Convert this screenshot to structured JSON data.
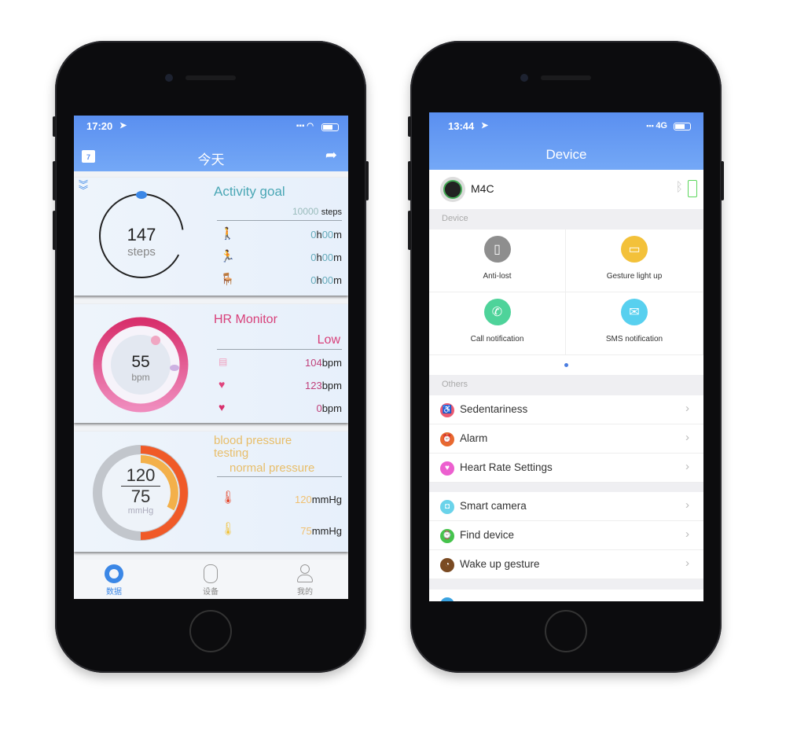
{
  "left_phone": {
    "status": {
      "time": "17:20",
      "location_icon": "location-arrow-icon",
      "signal_icon": "signal-icon",
      "wifi_icon": "wifi-icon",
      "battery_icon": "battery-icon"
    },
    "header": {
      "title": "今天",
      "calendar_day": "7"
    },
    "activity": {
      "title": "Activity goal",
      "steps_value": "147",
      "steps_unit": "steps",
      "goal_value": "10000",
      "goal_unit": "steps",
      "rows": [
        {
          "icon": "walking-icon",
          "h": "0",
          "m": "00"
        },
        {
          "icon": "running-icon",
          "h": "0",
          "m": "00"
        },
        {
          "icon": "sitting-icon",
          "h": "0",
          "m": "00"
        }
      ],
      "h_label": "h",
      "m_label": "m",
      "progress": 0.0147
    },
    "hr": {
      "title": "HR Monitor",
      "value": "55",
      "unit": "bpm",
      "status": "Low",
      "rows": [
        {
          "icon": "ecg-icon",
          "value": "104",
          "unit": "bpm"
        },
        {
          "icon": "heart-pulse-icon",
          "value": "123",
          "unit": "bpm"
        },
        {
          "icon": "heart-sleep-icon",
          "value": "0",
          "unit": "bpm"
        }
      ]
    },
    "bp": {
      "title": "blood pressure testing",
      "status": "normal pressure",
      "systolic": "120",
      "diastolic": "75",
      "unit": "mmHg",
      "rows": [
        {
          "icon": "thermometer-red-icon",
          "value": "120",
          "unit": "mmHg"
        },
        {
          "icon": "thermometer-yellow-icon",
          "value": "75",
          "unit": "mmHg"
        }
      ]
    },
    "tabs": [
      {
        "label": "数据",
        "active": true
      },
      {
        "label": "设备",
        "active": false
      },
      {
        "label": "我的",
        "active": false
      }
    ],
    "colors": {
      "accent": "#3b87e6",
      "hr": "#d8407a",
      "bp_high": "#f05a28",
      "bp_low": "#f3b04a"
    }
  },
  "right_phone": {
    "status": {
      "time": "13:44",
      "network": "4G"
    },
    "header": {
      "title": "Device"
    },
    "device": {
      "name": "M4C"
    },
    "device_section": "Device",
    "grid": [
      {
        "label": "Anti-lost",
        "icon": "phone-icon",
        "color": "#8e8e8e"
      },
      {
        "label": "Gesture light up",
        "icon": "wallet-icon",
        "color": "#f3c13a"
      },
      {
        "label": "Call notification",
        "icon": "call-icon",
        "color": "#4ed39a"
      },
      {
        "label": "SMS notification",
        "icon": "mail-icon",
        "color": "#58d0ef"
      }
    ],
    "others_section": "Others",
    "list1": [
      {
        "label": "Sedentariness",
        "icon": "sitting-icon",
        "color": "#ec5a72"
      },
      {
        "label": "Alarm",
        "icon": "alarm-icon",
        "color": "#e8692f"
      },
      {
        "label": "Heart Rate Settings",
        "icon": "heart-icon",
        "color": "#ec5fcf"
      }
    ],
    "list2": [
      {
        "label": "Smart camera",
        "icon": "camera-icon",
        "color": "#6ad3ea"
      },
      {
        "label": "Find device",
        "icon": "watch-icon",
        "color": "#45c34c"
      },
      {
        "label": "Wake up gesture",
        "icon": "wrist-icon",
        "color": "#7a4a22"
      }
    ]
  }
}
